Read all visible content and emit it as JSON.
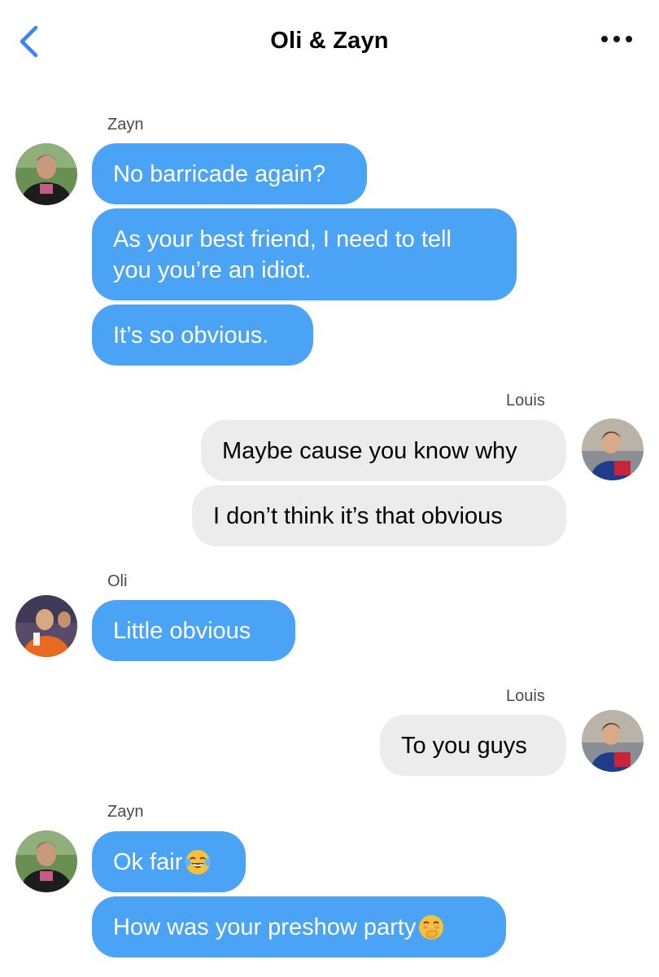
{
  "header": {
    "title": "Oli & Zayn",
    "back_icon": "chevron-left-icon",
    "more_icon": "ellipsis-icon"
  },
  "colors": {
    "accent": "#3b82f6",
    "incoming_bubble": "#4aa3f5",
    "outgoing_bubble": "#ececed"
  },
  "messages": {
    "g1": {
      "sender": "Zayn",
      "b1": "No barricade again?",
      "b2": "As your best friend, I need to tell\nyou you’re an idiot.",
      "b3": "It’s so obvious."
    },
    "g2": {
      "sender": "Louis",
      "b1": "Maybe cause you know why",
      "b2": "I don’t think it’s that obvious"
    },
    "g3": {
      "sender": "Oli",
      "b1": "Little obvious"
    },
    "g4": {
      "sender": "Louis",
      "b1": "To you guys"
    },
    "g5": {
      "sender": "Zayn",
      "b1": "Ok fair",
      "b1_emoji": "tears-of-joy-emoji",
      "b2": "How was your preshow party",
      "b2_emoji": "hand-over-mouth-emoji"
    }
  }
}
